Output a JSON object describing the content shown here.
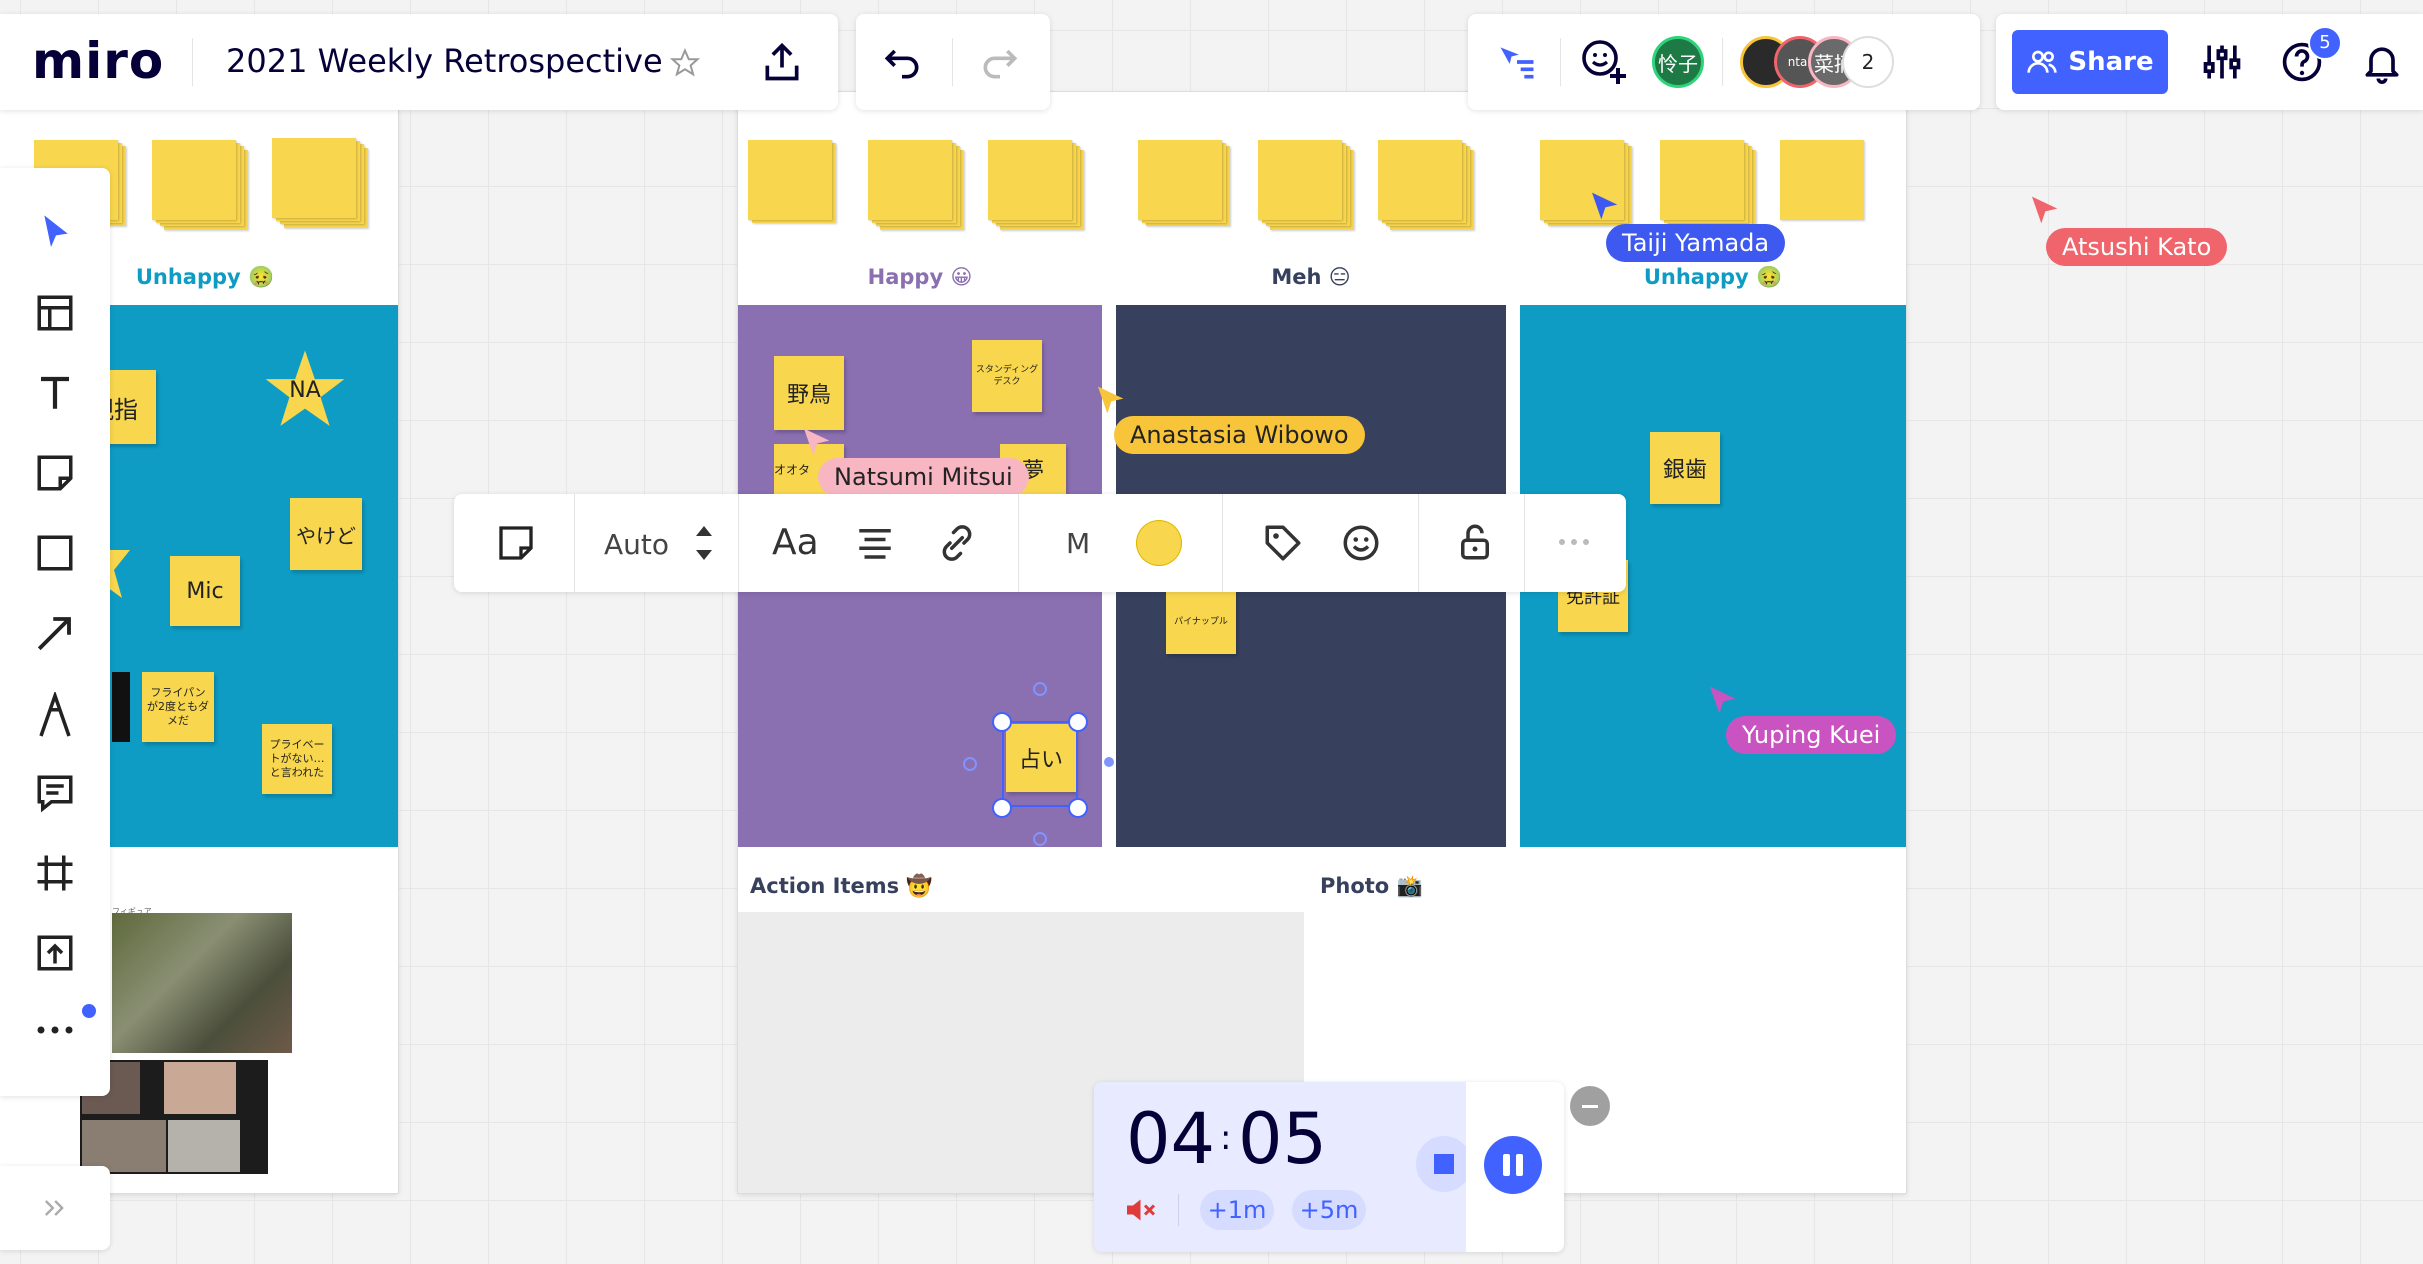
{
  "app": {
    "logo": "miro",
    "board_title": "2021 Weekly Retrospective",
    "star_icon": "star-outline-icon"
  },
  "header": {
    "share_label": "Share",
    "help_badge": "5",
    "collab_count": "2",
    "avatar_user1": "怜子",
    "avatar_user2": "菜摘",
    "avatar_partial": "ntar"
  },
  "left_frame": {
    "label": "Unhappy 🤢",
    "small_caption": "フィギュア",
    "stickies": [
      {
        "text": "親指"
      },
      {
        "text": "NA"
      },
      {
        "text": "やけど"
      },
      {
        "text": "Mic"
      },
      {
        "text": "フライパンが2度ともダメだ"
      },
      {
        "text": "プライベートがない…と言われた"
      }
    ]
  },
  "main_frame": {
    "columns": [
      {
        "label": "Happy 😀",
        "color": "#8a6fb1",
        "label_color": "#8a6fb1"
      },
      {
        "label": "Meh 😑",
        "color": "#37415e",
        "label_color": "#37415e"
      },
      {
        "label": "Unhappy 🤢",
        "color": "#0e9cc4",
        "label_color": "#0e9cc4"
      }
    ],
    "stickies": [
      {
        "text": "野鳥"
      },
      {
        "text": "スタンディングデスク"
      },
      {
        "text": "オオタ"
      },
      {
        "text": "夢"
      },
      {
        "text": "占い"
      },
      {
        "text": "パイナップル"
      },
      {
        "text": "銀歯"
      },
      {
        "text": "免許証"
      }
    ],
    "action_items_label": "Action Items 🤠",
    "photo_label": "Photo 📸"
  },
  "cursors": [
    {
      "name": "Taiji Yamada",
      "color": "#3d59f0"
    },
    {
      "name": "Atsushi Kato",
      "color": "#f0646c"
    },
    {
      "name": "Anastasia Wibowo",
      "color": "#f8c53a"
    },
    {
      "name": "Natsumi Mitsui",
      "color": "#f7b6c2"
    },
    {
      "name": "Yuping Kuei",
      "color": "#c953c1"
    }
  ],
  "context_toolbar": {
    "size_label": "Auto",
    "font_label": "Aa",
    "size_letter": "M",
    "sticky_color": "#f8d64e"
  },
  "timer": {
    "minutes": "04",
    "separator": ":",
    "seconds": "05",
    "plus1": "+1m",
    "plus5": "+5m"
  },
  "colors": {
    "accent": "#4262ff",
    "sticky": "#f8d64e"
  }
}
